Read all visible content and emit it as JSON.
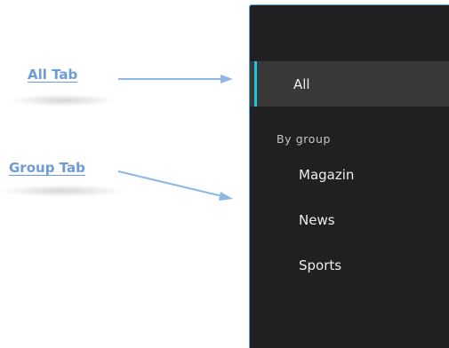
{
  "annotations": {
    "all_tab_label": "All Tab",
    "group_tab_label": "Group Tab",
    "label_color": "#6d9bd6",
    "arrow_color": "#8db8e6"
  },
  "sidebar": {
    "background": "#202020",
    "accent_color": "#1cc5e0",
    "all_item": {
      "label": "All",
      "selected": true
    },
    "group_header": "By group",
    "groups": [
      {
        "label": "Magazin"
      },
      {
        "label": "News"
      },
      {
        "label": "Sports"
      }
    ]
  }
}
